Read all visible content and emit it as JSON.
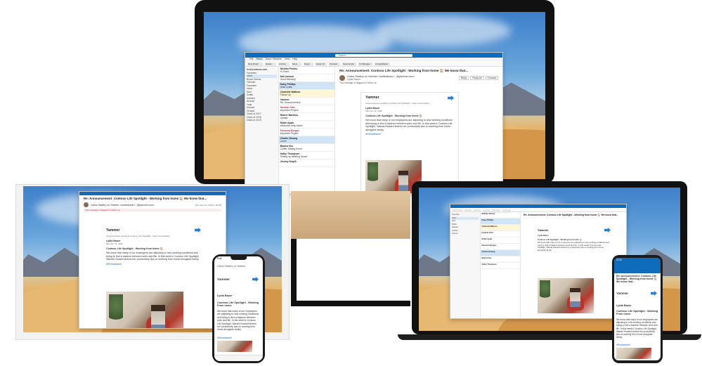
{
  "outlook_desktop": {
    "search_placeholder": "Search",
    "ribbon_tabs": [
      "File",
      "Home",
      "Send / Receive",
      "View",
      "Help"
    ],
    "ribbon_buttons": [
      "New Email",
      "Delete",
      "Archive",
      "Move",
      "Reply",
      "Reply All",
      "Forward",
      "Team Email",
      "To Manager",
      "Unread/Read"
    ],
    "account": "lee@contoso.com",
    "folders": [
      "Favorites",
      "Inbox",
      "Bryan Owens",
      "Yammer",
      "Favorites",
      "Inbox",
      "Sent",
      "Drafts",
      "Deleted",
      "Archive",
      "Junk",
      "Unread",
      "Groups",
      "Class of 2017",
      "Class of 2018",
      "Class of 2019"
    ],
    "mail_items": [
      {
        "from": "Nichiko Pishiru",
        "subject": "Hi Team,"
      },
      {
        "from": "Kat Larsson",
        "subject": "Good Morning!"
      },
      {
        "from": "Daisy Phillips",
        "subject": "Hello Lydia,"
      },
      {
        "from": "Charlotte Waltson",
        "subject": "Follow Up"
      },
      {
        "from": "Yammer",
        "subject": "Re: Announcement"
      },
      {
        "from": "Henrian Ortiz",
        "subject": "Important Project"
      },
      {
        "from": "Robert Martinez",
        "subject": "Update"
      },
      {
        "from": "Robin Ayala",
        "subject": "Welcome Kelly Harris"
      },
      {
        "from": "Eleonora Burgos",
        "subject": "Important Project"
      },
      {
        "from": "Charlie Zhuang",
        "subject": "Lunch"
      },
      {
        "from": "Bianca Seo",
        "subject": "Coffee Tasting Event"
      },
      {
        "from": "Kathy Thompson",
        "subject": "Setting up Meeting Space"
      },
      {
        "from": "Jeremy Smyth",
        "subject": ""
      }
    ],
    "reading_title": "Re: Announcement: Contoso Life Spotlight - Working from home 🏠 We know that...",
    "sender_line": "Carlos Slattery on Yammer <notifications+...@yammer.com>",
    "to_line": "Lydia Bauer",
    "flag_note": "This message is flagged for follow up.",
    "reply_buttons": [
      "Reply",
      "Reply All",
      "Forward"
    ],
    "yammer_brand": "Yammer",
    "announcement_meta": "Announcement posted in Contoso Life Spotlight · View Conversation",
    "poster_name": "Lydia Bauer",
    "poster_date": "Mon Apr 13, 2020",
    "post_title": "Contoso Life Spotlight - Working from home 🏠",
    "post_body": "We know that many of our employees are adjusting to new working conditions and trying to find a balance between work and life. In this week's Contoso Life Spotlight, Wanda Howard shares her productivity tips on working from home alongside family.",
    "hashtag": "#Remotework"
  },
  "outlook_web": {
    "reading_title": "Re: Announcement: Contoso Life Spotlight - Working from home 🏠 We know that...",
    "sender_line": "Carlos Slattery on Yammer <notifications+...@yammer.com>",
    "date": "Mon April 13, 2020 1:18 PM",
    "flag_note": "This message is flagged for follow up.",
    "yammer_brand": "Yammer",
    "announcement_meta": "Announcement posted in Contoso Life Spotlight · View Conversation",
    "poster_name": "Lydia Bauer",
    "poster_date": "Mon Apr 13, 2020",
    "post_title": "Contoso Life Spotlight - Working from home 🏠",
    "post_body": "We know that many of our employees are adjusting to new working conditions and trying to find a balance between work and life. In this week's Contoso Life Spotlight, Wanda Howard shares her productivity tips on working from home alongside family.",
    "hashtag": "#Remotework"
  },
  "phone_ios": {
    "time": "9:41",
    "header": "Carlos Slattery on Yammer",
    "yammer_brand": "Yammer",
    "poster_name": "Lydia Bauer",
    "post_title": "Contoso Life Spotlight - Working From home",
    "post_body": "We know that many of our employees are adjusting to new working conditions and trying to find a balance between work and life. In this week's Contoso Life Spotlight, Wanda Howard shares her productivity tips on working from home alongside family.",
    "hashtag": "#Remotework"
  },
  "phone_android": {
    "time": "12:30",
    "title": "Re: Announcement: Contoso Life Spotlight - Working from home 🏠 We know that...",
    "yammer_brand": "Yammer",
    "poster_name": "Lydia Bauer",
    "post_title": "Contoso Life Spotlight - Working From home",
    "post_body": "We know that many of our employees are adjusting to new working conditions and trying to find a balance between work and life. In this week's Contoso Life Spotlight, Wanda Howard shares her productivity tips on working from home alongside family.",
    "hashtag": "#Remotework"
  },
  "colors": {
    "outlook_blue": "#0f6cbd",
    "yammer_blue": "#2b7cd3",
    "flag_red": "#c4314b"
  }
}
